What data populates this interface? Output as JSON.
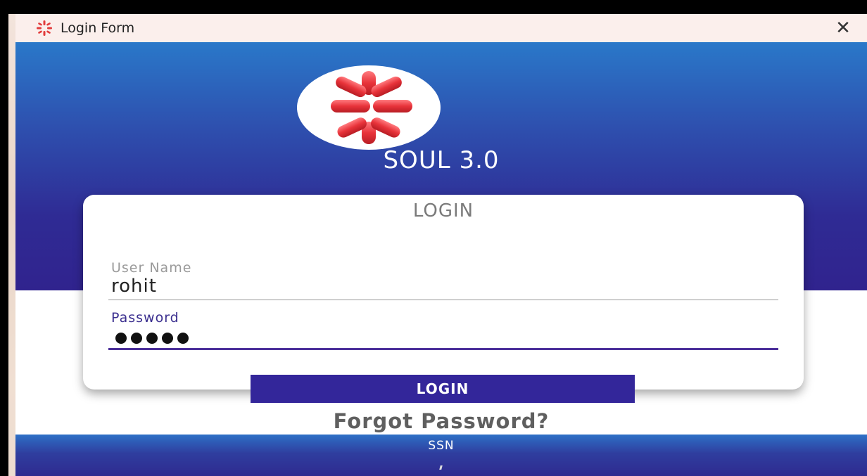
{
  "window": {
    "title": "Login Form",
    "close_icon": "close-icon",
    "title_icon": "soul-logo-icon"
  },
  "brand": {
    "name": "SOUL 3.0",
    "logo_icon": "soul-logo-icon"
  },
  "login_card": {
    "title": "LOGIN",
    "username": {
      "label": "User Name",
      "value": "rohit"
    },
    "password": {
      "label": "Password",
      "masked_length": 5
    }
  },
  "actions": {
    "login_button": "LOGIN",
    "forgot_link": "Forgot Password?"
  },
  "footer": {
    "text": "SSN"
  },
  "colors": {
    "hero_top": "#2a78c9",
    "hero_bottom": "#30238e",
    "button": "#33269a",
    "accent_underline": "#4b2f9a",
    "logo_red": "#e8333a"
  }
}
